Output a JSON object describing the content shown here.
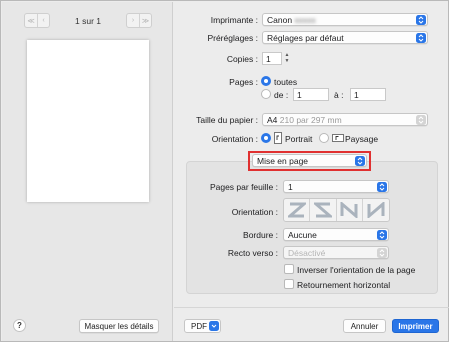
{
  "preview": {
    "prev_first_icon": "chevron-double-left",
    "prev_icon": "chevron-left",
    "next_icon": "chevron-right",
    "next_last_icon": "chevron-double-right",
    "page_counter": "1 sur 1",
    "help_label": "?",
    "hide_details_label": "Masquer les détails"
  },
  "settings": {
    "printer_label": "Imprimante :",
    "printer_value": "Canon",
    "printer_value_hidden": "xxxxx",
    "presets_label": "Préréglages :",
    "presets_value": "Réglages par défaut",
    "copies_label": "Copies :",
    "copies_value": "1",
    "pages_label": "Pages :",
    "pages_all_label": "toutes",
    "pages_from_label": "de :",
    "pages_from_value": "1",
    "pages_to_label": "à :",
    "pages_to_value": "1",
    "paper_size_label": "Taille du papier :",
    "paper_size_value": "A4",
    "paper_size_detail": "210 par 297 mm",
    "orientation_label": "Orientation :",
    "orientation_portrait": "Portrait",
    "orientation_landscape": "Paysage",
    "section_value": "Mise en page"
  },
  "layout": {
    "pages_per_sheet_label": "Pages par feuille :",
    "pages_per_sheet_value": "1",
    "layout_direction_label": "Orientation :",
    "border_label": "Bordure :",
    "border_value": "Aucune",
    "two_sided_label": "Recto verso :",
    "two_sided_value": "Désactivé",
    "reverse_orientation_label": "Inverser l'orientation de la page",
    "flip_horizontal_label": "Retournement horizontal"
  },
  "footer": {
    "pdf_label": "PDF",
    "cancel_label": "Annuler",
    "print_label": "Imprimer"
  },
  "colors": {
    "accent": "#2a76e8",
    "highlight": "#e03030"
  }
}
